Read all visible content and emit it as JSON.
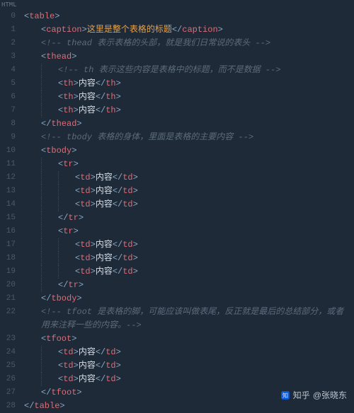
{
  "language_label": "HTML",
  "watermark": {
    "brand": "知乎",
    "author": "@张晓东"
  },
  "line_height": 19,
  "indent_unit": 24,
  "lines": [
    {
      "n": 0,
      "indent": 0,
      "guides": [],
      "segs": [
        {
          "t": "br",
          "v": "<"
        },
        {
          "t": "tn",
          "v": "table"
        },
        {
          "t": "br",
          "v": ">"
        }
      ]
    },
    {
      "n": 1,
      "indent": 1,
      "guides": [],
      "segs": [
        {
          "t": "br",
          "v": "<"
        },
        {
          "t": "tn",
          "v": "caption"
        },
        {
          "t": "br",
          "v": ">"
        },
        {
          "t": "cap",
          "v": "这里是整个表格的标题"
        },
        {
          "t": "br",
          "v": "</"
        },
        {
          "t": "tn",
          "v": "caption"
        },
        {
          "t": "br",
          "v": ">"
        }
      ]
    },
    {
      "n": 2,
      "indent": 1,
      "guides": [],
      "segs": [
        {
          "t": "cm",
          "v": "<!-- thead 表示表格的头部，就是我们日常说的表头 -->"
        }
      ]
    },
    {
      "n": 3,
      "indent": 1,
      "guides": [],
      "segs": [
        {
          "t": "br",
          "v": "<"
        },
        {
          "t": "tn",
          "v": "thead"
        },
        {
          "t": "br",
          "v": ">"
        }
      ]
    },
    {
      "n": 4,
      "indent": 2,
      "guides": [
        1
      ],
      "segs": [
        {
          "t": "cm",
          "v": "<!-- th 表示这些内容是表格中的标题，而不是数据 -->"
        }
      ]
    },
    {
      "n": 5,
      "indent": 2,
      "guides": [
        1
      ],
      "segs": [
        {
          "t": "br",
          "v": "<"
        },
        {
          "t": "tn",
          "v": "th"
        },
        {
          "t": "br",
          "v": ">"
        },
        {
          "t": "txt",
          "v": "内容"
        },
        {
          "t": "br",
          "v": "</"
        },
        {
          "t": "tn",
          "v": "th"
        },
        {
          "t": "br",
          "v": ">"
        }
      ]
    },
    {
      "n": 6,
      "indent": 2,
      "guides": [
        1
      ],
      "segs": [
        {
          "t": "br",
          "v": "<"
        },
        {
          "t": "tn",
          "v": "th"
        },
        {
          "t": "br",
          "v": ">"
        },
        {
          "t": "txt",
          "v": "内容"
        },
        {
          "t": "br",
          "v": "</"
        },
        {
          "t": "tn",
          "v": "th"
        },
        {
          "t": "br",
          "v": ">"
        }
      ]
    },
    {
      "n": 7,
      "indent": 2,
      "guides": [
        1
      ],
      "segs": [
        {
          "t": "br",
          "v": "<"
        },
        {
          "t": "tn",
          "v": "th"
        },
        {
          "t": "br",
          "v": ">"
        },
        {
          "t": "txt",
          "v": "内容"
        },
        {
          "t": "br",
          "v": "</"
        },
        {
          "t": "tn",
          "v": "th"
        },
        {
          "t": "br",
          "v": ">"
        }
      ]
    },
    {
      "n": 8,
      "indent": 1,
      "guides": [],
      "segs": [
        {
          "t": "br",
          "v": "</"
        },
        {
          "t": "tn",
          "v": "thead"
        },
        {
          "t": "br",
          "v": ">"
        }
      ]
    },
    {
      "n": 9,
      "indent": 1,
      "guides": [],
      "segs": [
        {
          "t": "cm",
          "v": "<!-- tbody 表格的身体，里面是表格的主要内容 -->"
        }
      ]
    },
    {
      "n": 10,
      "indent": 1,
      "guides": [],
      "segs": [
        {
          "t": "br",
          "v": "<"
        },
        {
          "t": "tn",
          "v": "tbody"
        },
        {
          "t": "br",
          "v": ">"
        }
      ]
    },
    {
      "n": 11,
      "indent": 2,
      "guides": [
        1
      ],
      "segs": [
        {
          "t": "br",
          "v": "<"
        },
        {
          "t": "tn",
          "v": "tr"
        },
        {
          "t": "br",
          "v": ">"
        }
      ]
    },
    {
      "n": 12,
      "indent": 3,
      "guides": [
        1,
        2
      ],
      "segs": [
        {
          "t": "br",
          "v": "<"
        },
        {
          "t": "tn",
          "v": "td"
        },
        {
          "t": "br",
          "v": ">"
        },
        {
          "t": "txt",
          "v": "内容"
        },
        {
          "t": "br",
          "v": "</"
        },
        {
          "t": "tn",
          "v": "td"
        },
        {
          "t": "br",
          "v": ">"
        }
      ]
    },
    {
      "n": 13,
      "indent": 3,
      "guides": [
        1,
        2
      ],
      "segs": [
        {
          "t": "br",
          "v": "<"
        },
        {
          "t": "tn",
          "v": "td"
        },
        {
          "t": "br",
          "v": ">"
        },
        {
          "t": "txt",
          "v": "内容"
        },
        {
          "t": "br",
          "v": "</"
        },
        {
          "t": "tn",
          "v": "td"
        },
        {
          "t": "br",
          "v": ">"
        }
      ]
    },
    {
      "n": 14,
      "indent": 3,
      "guides": [
        1,
        2
      ],
      "segs": [
        {
          "t": "br",
          "v": "<"
        },
        {
          "t": "tn",
          "v": "td"
        },
        {
          "t": "br",
          "v": ">"
        },
        {
          "t": "txt",
          "v": "内容"
        },
        {
          "t": "br",
          "v": "</"
        },
        {
          "t": "tn",
          "v": "td"
        },
        {
          "t": "br",
          "v": ">"
        }
      ]
    },
    {
      "n": 15,
      "indent": 2,
      "guides": [
        1
      ],
      "segs": [
        {
          "t": "br",
          "v": "</"
        },
        {
          "t": "tn",
          "v": "tr"
        },
        {
          "t": "br",
          "v": ">"
        }
      ]
    },
    {
      "n": 16,
      "indent": 2,
      "guides": [
        1
      ],
      "segs": [
        {
          "t": "br",
          "v": "<"
        },
        {
          "t": "tn",
          "v": "tr"
        },
        {
          "t": "br",
          "v": ">"
        }
      ]
    },
    {
      "n": 17,
      "indent": 3,
      "guides": [
        1,
        2
      ],
      "segs": [
        {
          "t": "br",
          "v": "<"
        },
        {
          "t": "tn",
          "v": "td"
        },
        {
          "t": "br",
          "v": ">"
        },
        {
          "t": "txt",
          "v": "内容"
        },
        {
          "t": "br",
          "v": "</"
        },
        {
          "t": "tn",
          "v": "td"
        },
        {
          "t": "br",
          "v": ">"
        }
      ]
    },
    {
      "n": 18,
      "indent": 3,
      "guides": [
        1,
        2
      ],
      "segs": [
        {
          "t": "br",
          "v": "<"
        },
        {
          "t": "tn",
          "v": "td"
        },
        {
          "t": "br",
          "v": ">"
        },
        {
          "t": "txt",
          "v": "内容"
        },
        {
          "t": "br",
          "v": "</"
        },
        {
          "t": "tn",
          "v": "td"
        },
        {
          "t": "br",
          "v": ">"
        }
      ]
    },
    {
      "n": 19,
      "indent": 3,
      "guides": [
        1,
        2
      ],
      "segs": [
        {
          "t": "br",
          "v": "<"
        },
        {
          "t": "tn",
          "v": "td"
        },
        {
          "t": "br",
          "v": ">"
        },
        {
          "t": "txt",
          "v": "内容"
        },
        {
          "t": "br",
          "v": "</"
        },
        {
          "t": "tn",
          "v": "td"
        },
        {
          "t": "br",
          "v": ">"
        }
      ]
    },
    {
      "n": 20,
      "indent": 2,
      "guides": [
        1
      ],
      "segs": [
        {
          "t": "br",
          "v": "</"
        },
        {
          "t": "tn",
          "v": "tr"
        },
        {
          "t": "br",
          "v": ">"
        }
      ]
    },
    {
      "n": 21,
      "indent": 1,
      "guides": [],
      "segs": [
        {
          "t": "br",
          "v": "</"
        },
        {
          "t": "tn",
          "v": "tbody"
        },
        {
          "t": "br",
          "v": ">"
        }
      ]
    },
    {
      "n": 22,
      "indent": 1,
      "guides": [],
      "segs": [
        {
          "t": "cm",
          "v": "<!-- tfoot 是表格的脚，可能应该叫做表尾，反正就是最后的总结部分，或者用来注释一些的内容。-->"
        }
      ],
      "wrap": true
    },
    {
      "n": 23,
      "indent": 1,
      "guides": [],
      "segs": [
        {
          "t": "br",
          "v": "<"
        },
        {
          "t": "tn",
          "v": "tfoot"
        },
        {
          "t": "br",
          "v": ">"
        }
      ]
    },
    {
      "n": 24,
      "indent": 2,
      "guides": [
        1
      ],
      "segs": [
        {
          "t": "br",
          "v": "<"
        },
        {
          "t": "tn",
          "v": "td"
        },
        {
          "t": "br",
          "v": ">"
        },
        {
          "t": "txt",
          "v": "内容"
        },
        {
          "t": "br",
          "v": "</"
        },
        {
          "t": "tn",
          "v": "td"
        },
        {
          "t": "br",
          "v": ">"
        }
      ]
    },
    {
      "n": 25,
      "indent": 2,
      "guides": [
        1
      ],
      "segs": [
        {
          "t": "br",
          "v": "<"
        },
        {
          "t": "tn",
          "v": "td"
        },
        {
          "t": "br",
          "v": ">"
        },
        {
          "t": "txt",
          "v": "内容"
        },
        {
          "t": "br",
          "v": "</"
        },
        {
          "t": "tn",
          "v": "td"
        },
        {
          "t": "br",
          "v": ">"
        }
      ]
    },
    {
      "n": 26,
      "indent": 2,
      "guides": [
        1
      ],
      "segs": [
        {
          "t": "br",
          "v": "<"
        },
        {
          "t": "tn",
          "v": "td"
        },
        {
          "t": "br",
          "v": ">"
        },
        {
          "t": "txt",
          "v": "内容"
        },
        {
          "t": "br",
          "v": "</"
        },
        {
          "t": "tn",
          "v": "td"
        },
        {
          "t": "br",
          "v": ">"
        }
      ]
    },
    {
      "n": 27,
      "indent": 1,
      "guides": [],
      "segs": [
        {
          "t": "br",
          "v": "</"
        },
        {
          "t": "tn",
          "v": "tfoot"
        },
        {
          "t": "br",
          "v": ">"
        }
      ]
    },
    {
      "n": 28,
      "indent": 0,
      "guides": [],
      "segs": [
        {
          "t": "br",
          "v": "</"
        },
        {
          "t": "tn",
          "v": "table"
        },
        {
          "t": "br",
          "v": ">"
        }
      ]
    }
  ]
}
